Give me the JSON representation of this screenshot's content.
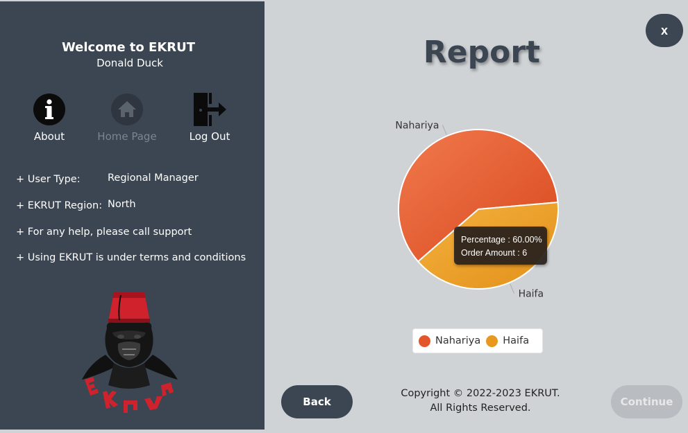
{
  "sidebar": {
    "welcome": "Welcome to EKRUT",
    "user_name": "Donald Duck",
    "nav": {
      "about": "About",
      "home": "Home Page",
      "logout": "Log Out"
    },
    "info": {
      "user_type_label": "+ User Type:",
      "user_type_value": "Regional Manager",
      "region_label": "+ EKRUT Region:",
      "region_value": "North",
      "help": "+ For any help, please call support",
      "terms": "+ Using EKRUT is under terms and conditions"
    },
    "logo_text": "EKRUT"
  },
  "header": {
    "close_label": "x",
    "title": "Report"
  },
  "chart_data": {
    "type": "pie",
    "slices": [
      {
        "label": "Nahariya",
        "value": 6,
        "percent": 60.0,
        "color": "#e3552a"
      },
      {
        "label": "Haifa",
        "value": 4,
        "percent": 40.0,
        "color": "#e8981d"
      }
    ],
    "legend": [
      "Nahariya",
      "Haifa"
    ],
    "legend_position": "bottom",
    "tooltip": {
      "line1": "Percentage : 60.00%",
      "line2": "Order Amount : 6"
    }
  },
  "footer": {
    "back_label": "Back",
    "continue_label": "Continue",
    "copyright_line1": "Copyright © 2022-2023 EKRUT.",
    "copyright_line2": "All Rights Reserved."
  },
  "colors": {
    "sidebar_bg": "#3b4652",
    "main_bg": "#d0d3d6",
    "nahariya": "#e3552a",
    "haifa": "#e8981d"
  },
  "icons": {
    "about": "info-icon",
    "home": "home-icon",
    "logout": "logout-icon",
    "close": "close-icon"
  }
}
